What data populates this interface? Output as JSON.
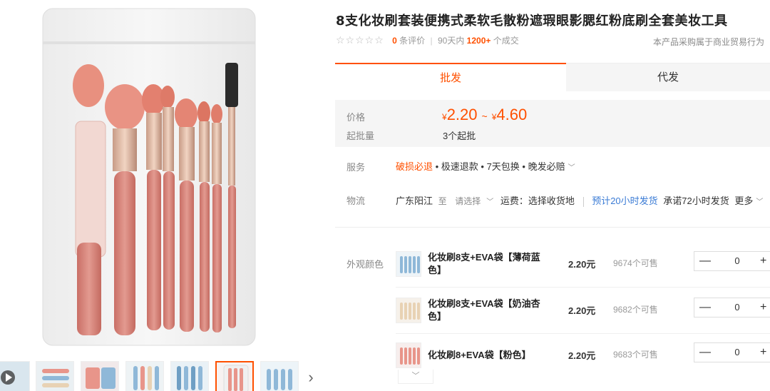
{
  "product": {
    "title": "8支化妆刷套装便携式柔软毛散粉遮瑕眼影腮红粉底刷全套美妆工具",
    "stars": "☆☆☆☆☆",
    "review_count": "0",
    "review_label": "条评价",
    "sales_period": "90天内",
    "sales_count": "1200+",
    "sales_suffix": "个成交",
    "business_note": "本产品采购属于商业贸易行为"
  },
  "tabs": {
    "wholesale": "批发",
    "dropship": "代发"
  },
  "pricing": {
    "price_label": "价格",
    "currency": "¥",
    "price_low": "2.20",
    "tilde": "~",
    "price_high": "4.60",
    "moq_label": "起批量",
    "moq_value": "3个起批"
  },
  "service": {
    "label": "服务",
    "highlight": "破损必退",
    "rest": " • 极速退款 • 7天包换 • 晚发必赔"
  },
  "logistics": {
    "label": "物流",
    "origin": "广东阳江",
    "to": "至",
    "select_prompt": "请选择",
    "freight": "运费：选择收货地",
    "eta": "预计20小时发货",
    "promise": "承诺72小时发货",
    "more": "更多"
  },
  "sku": {
    "label": "外观颜色",
    "items": [
      {
        "name": "化妆刷8支+EVA袋【薄荷蓝色】",
        "price": "2.20元",
        "stock": "9674个可售",
        "qty": "0"
      },
      {
        "name": "化妆刷8支+EVA袋【奶油杏色】",
        "price": "2.20元",
        "stock": "9682个可售",
        "qty": "0"
      },
      {
        "name": "化妆刷8+EVA袋【粉色】",
        "price": "2.20元",
        "stock": "9683个可售",
        "qty": "0"
      }
    ],
    "minus": "—",
    "plus": "+"
  },
  "icons": {
    "next": "chevron-right-icon",
    "expand": "chevron-down-icon",
    "video": "play-icon"
  },
  "colors": {
    "accent": "#ff5000",
    "link_blue": "#3a7bd5",
    "swatch_blue": "#8fb8d8",
    "swatch_apricot": "#e8d2b4",
    "swatch_pink": "#e8958a"
  }
}
